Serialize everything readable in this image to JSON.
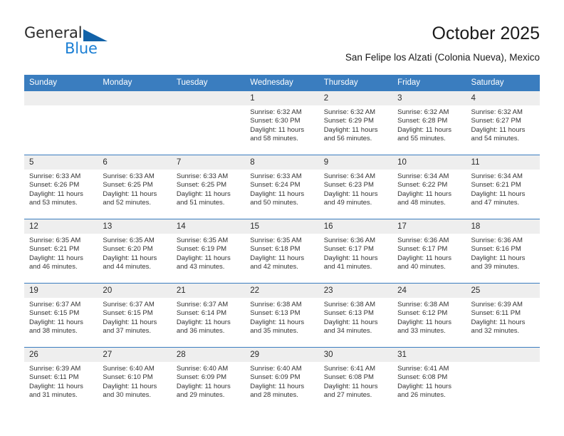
{
  "brand": {
    "name_top": "General",
    "name_bottom": "Blue",
    "accent_color": "#1b7fd4",
    "triangle_color": "#1262a8"
  },
  "header": {
    "title": "October 2025",
    "subtitle": "San Felipe los Alzati (Colonia Nueva), Mexico"
  },
  "theme": {
    "header_row_bg": "#3a7dbf",
    "daynum_bg": "#eeeeee",
    "grid_line": "#3a7dbf",
    "text": "#333333"
  },
  "weekdays": [
    "Sunday",
    "Monday",
    "Tuesday",
    "Wednesday",
    "Thursday",
    "Friday",
    "Saturday"
  ],
  "weeks": [
    [
      {
        "day": "",
        "empty": true
      },
      {
        "day": "",
        "empty": true
      },
      {
        "day": "",
        "empty": true
      },
      {
        "day": "1",
        "sunrise": "Sunrise: 6:32 AM",
        "sunset": "Sunset: 6:30 PM",
        "daylight1": "Daylight: 11 hours",
        "daylight2": "and 58 minutes."
      },
      {
        "day": "2",
        "sunrise": "Sunrise: 6:32 AM",
        "sunset": "Sunset: 6:29 PM",
        "daylight1": "Daylight: 11 hours",
        "daylight2": "and 56 minutes."
      },
      {
        "day": "3",
        "sunrise": "Sunrise: 6:32 AM",
        "sunset": "Sunset: 6:28 PM",
        "daylight1": "Daylight: 11 hours",
        "daylight2": "and 55 minutes."
      },
      {
        "day": "4",
        "sunrise": "Sunrise: 6:32 AM",
        "sunset": "Sunset: 6:27 PM",
        "daylight1": "Daylight: 11 hours",
        "daylight2": "and 54 minutes."
      }
    ],
    [
      {
        "day": "5",
        "sunrise": "Sunrise: 6:33 AM",
        "sunset": "Sunset: 6:26 PM",
        "daylight1": "Daylight: 11 hours",
        "daylight2": "and 53 minutes."
      },
      {
        "day": "6",
        "sunrise": "Sunrise: 6:33 AM",
        "sunset": "Sunset: 6:25 PM",
        "daylight1": "Daylight: 11 hours",
        "daylight2": "and 52 minutes."
      },
      {
        "day": "7",
        "sunrise": "Sunrise: 6:33 AM",
        "sunset": "Sunset: 6:25 PM",
        "daylight1": "Daylight: 11 hours",
        "daylight2": "and 51 minutes."
      },
      {
        "day": "8",
        "sunrise": "Sunrise: 6:33 AM",
        "sunset": "Sunset: 6:24 PM",
        "daylight1": "Daylight: 11 hours",
        "daylight2": "and 50 minutes."
      },
      {
        "day": "9",
        "sunrise": "Sunrise: 6:34 AM",
        "sunset": "Sunset: 6:23 PM",
        "daylight1": "Daylight: 11 hours",
        "daylight2": "and 49 minutes."
      },
      {
        "day": "10",
        "sunrise": "Sunrise: 6:34 AM",
        "sunset": "Sunset: 6:22 PM",
        "daylight1": "Daylight: 11 hours",
        "daylight2": "and 48 minutes."
      },
      {
        "day": "11",
        "sunrise": "Sunrise: 6:34 AM",
        "sunset": "Sunset: 6:21 PM",
        "daylight1": "Daylight: 11 hours",
        "daylight2": "and 47 minutes."
      }
    ],
    [
      {
        "day": "12",
        "sunrise": "Sunrise: 6:35 AM",
        "sunset": "Sunset: 6:21 PM",
        "daylight1": "Daylight: 11 hours",
        "daylight2": "and 46 minutes."
      },
      {
        "day": "13",
        "sunrise": "Sunrise: 6:35 AM",
        "sunset": "Sunset: 6:20 PM",
        "daylight1": "Daylight: 11 hours",
        "daylight2": "and 44 minutes."
      },
      {
        "day": "14",
        "sunrise": "Sunrise: 6:35 AM",
        "sunset": "Sunset: 6:19 PM",
        "daylight1": "Daylight: 11 hours",
        "daylight2": "and 43 minutes."
      },
      {
        "day": "15",
        "sunrise": "Sunrise: 6:35 AM",
        "sunset": "Sunset: 6:18 PM",
        "daylight1": "Daylight: 11 hours",
        "daylight2": "and 42 minutes."
      },
      {
        "day": "16",
        "sunrise": "Sunrise: 6:36 AM",
        "sunset": "Sunset: 6:17 PM",
        "daylight1": "Daylight: 11 hours",
        "daylight2": "and 41 minutes."
      },
      {
        "day": "17",
        "sunrise": "Sunrise: 6:36 AM",
        "sunset": "Sunset: 6:17 PM",
        "daylight1": "Daylight: 11 hours",
        "daylight2": "and 40 minutes."
      },
      {
        "day": "18",
        "sunrise": "Sunrise: 6:36 AM",
        "sunset": "Sunset: 6:16 PM",
        "daylight1": "Daylight: 11 hours",
        "daylight2": "and 39 minutes."
      }
    ],
    [
      {
        "day": "19",
        "sunrise": "Sunrise: 6:37 AM",
        "sunset": "Sunset: 6:15 PM",
        "daylight1": "Daylight: 11 hours",
        "daylight2": "and 38 minutes."
      },
      {
        "day": "20",
        "sunrise": "Sunrise: 6:37 AM",
        "sunset": "Sunset: 6:15 PM",
        "daylight1": "Daylight: 11 hours",
        "daylight2": "and 37 minutes."
      },
      {
        "day": "21",
        "sunrise": "Sunrise: 6:37 AM",
        "sunset": "Sunset: 6:14 PM",
        "daylight1": "Daylight: 11 hours",
        "daylight2": "and 36 minutes."
      },
      {
        "day": "22",
        "sunrise": "Sunrise: 6:38 AM",
        "sunset": "Sunset: 6:13 PM",
        "daylight1": "Daylight: 11 hours",
        "daylight2": "and 35 minutes."
      },
      {
        "day": "23",
        "sunrise": "Sunrise: 6:38 AM",
        "sunset": "Sunset: 6:13 PM",
        "daylight1": "Daylight: 11 hours",
        "daylight2": "and 34 minutes."
      },
      {
        "day": "24",
        "sunrise": "Sunrise: 6:38 AM",
        "sunset": "Sunset: 6:12 PM",
        "daylight1": "Daylight: 11 hours",
        "daylight2": "and 33 minutes."
      },
      {
        "day": "25",
        "sunrise": "Sunrise: 6:39 AM",
        "sunset": "Sunset: 6:11 PM",
        "daylight1": "Daylight: 11 hours",
        "daylight2": "and 32 minutes."
      }
    ],
    [
      {
        "day": "26",
        "sunrise": "Sunrise: 6:39 AM",
        "sunset": "Sunset: 6:11 PM",
        "daylight1": "Daylight: 11 hours",
        "daylight2": "and 31 minutes."
      },
      {
        "day": "27",
        "sunrise": "Sunrise: 6:40 AM",
        "sunset": "Sunset: 6:10 PM",
        "daylight1": "Daylight: 11 hours",
        "daylight2": "and 30 minutes."
      },
      {
        "day": "28",
        "sunrise": "Sunrise: 6:40 AM",
        "sunset": "Sunset: 6:09 PM",
        "daylight1": "Daylight: 11 hours",
        "daylight2": "and 29 minutes."
      },
      {
        "day": "29",
        "sunrise": "Sunrise: 6:40 AM",
        "sunset": "Sunset: 6:09 PM",
        "daylight1": "Daylight: 11 hours",
        "daylight2": "and 28 minutes."
      },
      {
        "day": "30",
        "sunrise": "Sunrise: 6:41 AM",
        "sunset": "Sunset: 6:08 PM",
        "daylight1": "Daylight: 11 hours",
        "daylight2": "and 27 minutes."
      },
      {
        "day": "31",
        "sunrise": "Sunrise: 6:41 AM",
        "sunset": "Sunset: 6:08 PM",
        "daylight1": "Daylight: 11 hours",
        "daylight2": "and 26 minutes."
      },
      {
        "day": "",
        "empty": true
      }
    ]
  ]
}
